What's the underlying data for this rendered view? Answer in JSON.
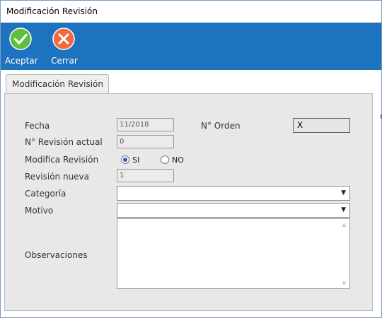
{
  "window": {
    "title": "Modificación Revisión"
  },
  "toolbar": {
    "accept_label": "Aceptar",
    "close_label": "Cerrar",
    "accept_icon": "check-circle-icon",
    "close_icon": "x-circle-icon",
    "accept_color": "#5fbf3a",
    "close_color": "#f26a3d",
    "bar_color": "#1d73bf"
  },
  "tab": {
    "label": "Modificación Revisión"
  },
  "form": {
    "fecha_label": "Fecha",
    "fecha_value": "11/2018",
    "orden_label": "N° Orden",
    "orden_value": "X",
    "revision_actual_label": "N° Revisión actual",
    "revision_actual_value": "0",
    "modifica_label": "Modifica Revisión",
    "radio_si_label": "SI",
    "radio_no_label": "NO",
    "modifica_selected": "SI",
    "revision_nueva_label": "Revisión nueva",
    "revision_nueva_value": "1",
    "categoria_label": "Categoría",
    "categoria_value": "",
    "motivo_label": "Motivo",
    "motivo_value": "",
    "observaciones_label": "Observaciones",
    "observaciones_value": ""
  },
  "edge_text": "r"
}
